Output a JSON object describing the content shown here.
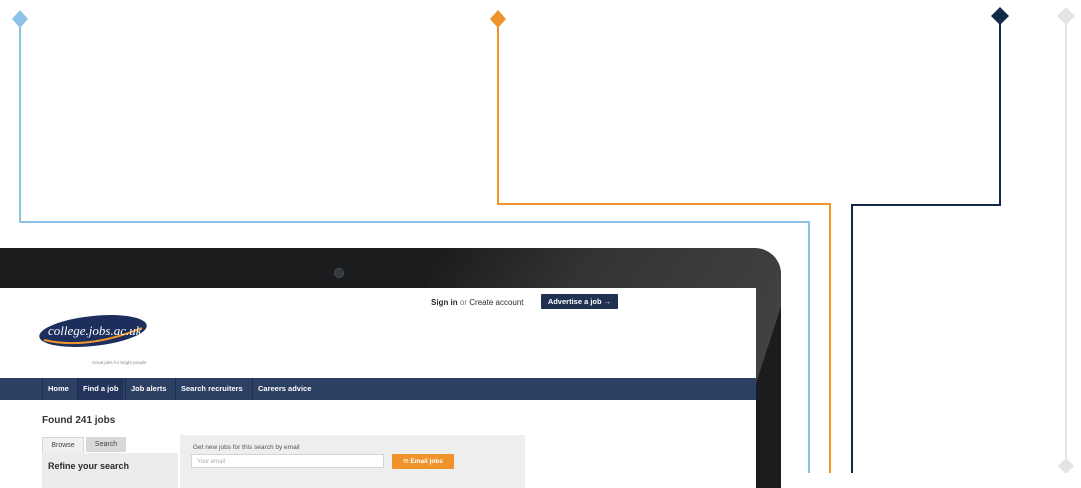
{
  "header": {
    "sign_in": "Sign in",
    "or": "or",
    "create_account": "Create account",
    "advertise": "Advertise a job →",
    "logo_text": "college.jobs.ac.uk",
    "tagline": "Great jobs for bright people"
  },
  "nav": {
    "items": [
      "Home",
      "Find a job",
      "Job alerts",
      "Search recruiters",
      "Careers advice"
    ]
  },
  "results": {
    "found": "Found 241 jobs"
  },
  "sidebar": {
    "tabs": [
      "Browse",
      "Search"
    ],
    "refine_title": "Refine your search"
  },
  "email_alert": {
    "label": "Get new jobs for this search by email",
    "placeholder": "Your email",
    "button": "✉ Email jobs"
  },
  "colors": {
    "connector_blue": "#8cc2e6",
    "connector_orange": "#f0932b",
    "connector_navy": "#14284a",
    "connector_grey": "#e4e4e6",
    "nav_bg": "#2c4063",
    "accent_button": "#f0932b"
  }
}
